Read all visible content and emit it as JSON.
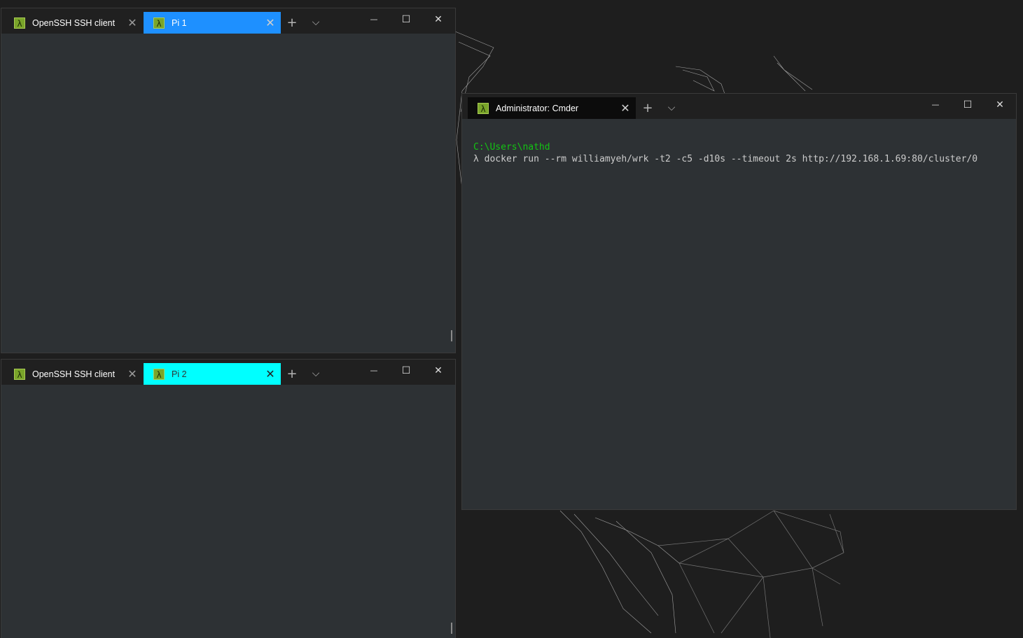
{
  "window1": {
    "tabs": [
      {
        "label": "OpenSSH SSH client",
        "icon": "lambda-icon",
        "state": "inactive"
      },
      {
        "label": "Pi 1",
        "icon": "lambda-icon",
        "state": "active",
        "color": "#1e90ff"
      }
    ]
  },
  "window2": {
    "tabs": [
      {
        "label": "OpenSSH SSH client",
        "icon": "lambda-icon",
        "state": "inactive"
      },
      {
        "label": "Pi 2",
        "icon": "lambda-icon",
        "state": "active",
        "color": "#00ffff"
      }
    ]
  },
  "window3": {
    "tabs": [
      {
        "label": "Administrator: Cmder",
        "icon": "lambda-icon",
        "state": "active"
      }
    ],
    "terminal": {
      "path": "C:\\Users\\nathd",
      "command": "λ docker run --rm williamyeh/wrk -t2 -c5 -d10s --timeout 2s http://192.168.1.69:80/cluster/0"
    }
  },
  "glyphs": {
    "lambda": "λ",
    "close": "✕",
    "new_tab": "+",
    "dropdown": "⌵",
    "minimize": "—",
    "maximize": "☐",
    "window_close": "✕"
  },
  "colors": {
    "terminal_bg": "#2d3134",
    "titlebar_bg": "#202020",
    "prompt_path": "#13c413",
    "icon_green": "#7aa52a"
  }
}
